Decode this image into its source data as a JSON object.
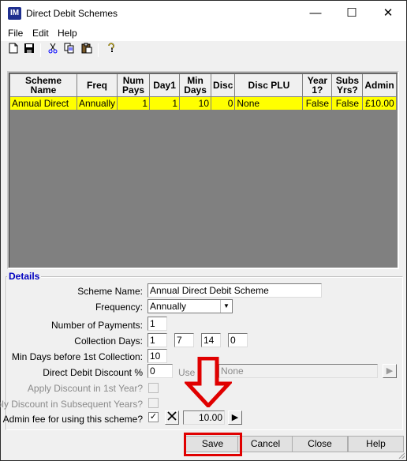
{
  "window": {
    "title": "Direct Debit Schemes",
    "icon_text": "IM"
  },
  "window_controls": {
    "minimize": "—",
    "maximize": "☐",
    "close": "✕"
  },
  "menu": [
    {
      "label": "File"
    },
    {
      "label": "Edit"
    },
    {
      "label": "Help"
    }
  ],
  "toolbar": {
    "new_icon": "new-document-icon",
    "save_icon": "save-icon",
    "cut_icon": "cut-icon",
    "copy_icon": "copy-icon",
    "paste_icon": "paste-icon",
    "help_icon": "help-question-icon"
  },
  "grid": {
    "headers": [
      "Scheme Name",
      "Freq",
      "Num Pays",
      "Day1",
      "Min Days",
      "Disc",
      "Disc PLU",
      "Year 1?",
      "Subs Yrs?",
      "Admin"
    ],
    "rows": [
      [
        "Annual Direct",
        "Annually",
        "1",
        "1",
        "10",
        "0",
        "None",
        "False",
        "False",
        "£10.00"
      ]
    ]
  },
  "details": {
    "group_label": "Details",
    "scheme_name_label": "Scheme Name:",
    "scheme_name_value": "Annual Direct Debit Scheme",
    "frequency_label": "Frequency:",
    "frequency_value": "Annually",
    "num_payments_label": "Number of Payments:",
    "num_payments_value": "1",
    "collection_days_label": "Collection Days:",
    "collection_days": [
      "1",
      "7",
      "14",
      "0"
    ],
    "min_days_label": "Min Days before 1st Collection:",
    "min_days_value": "10",
    "discount_label": "Direct Debit Discount %",
    "discount_value": "0",
    "use_label": "Use",
    "plu_value": "None",
    "apply_first_label": "Apply Discount in 1st Year?",
    "apply_subsequent_label": "Apply Discount in Subsequent Years?",
    "admin_fee_label": "Admin fee for using this scheme?",
    "admin_fee_checked": "✓",
    "admin_fee_value": "10.00"
  },
  "buttons": {
    "save": "Save",
    "cancel": "Cancel",
    "close": "Close",
    "help": "Help"
  },
  "annotation": {
    "arrow_color": "#e00000"
  }
}
